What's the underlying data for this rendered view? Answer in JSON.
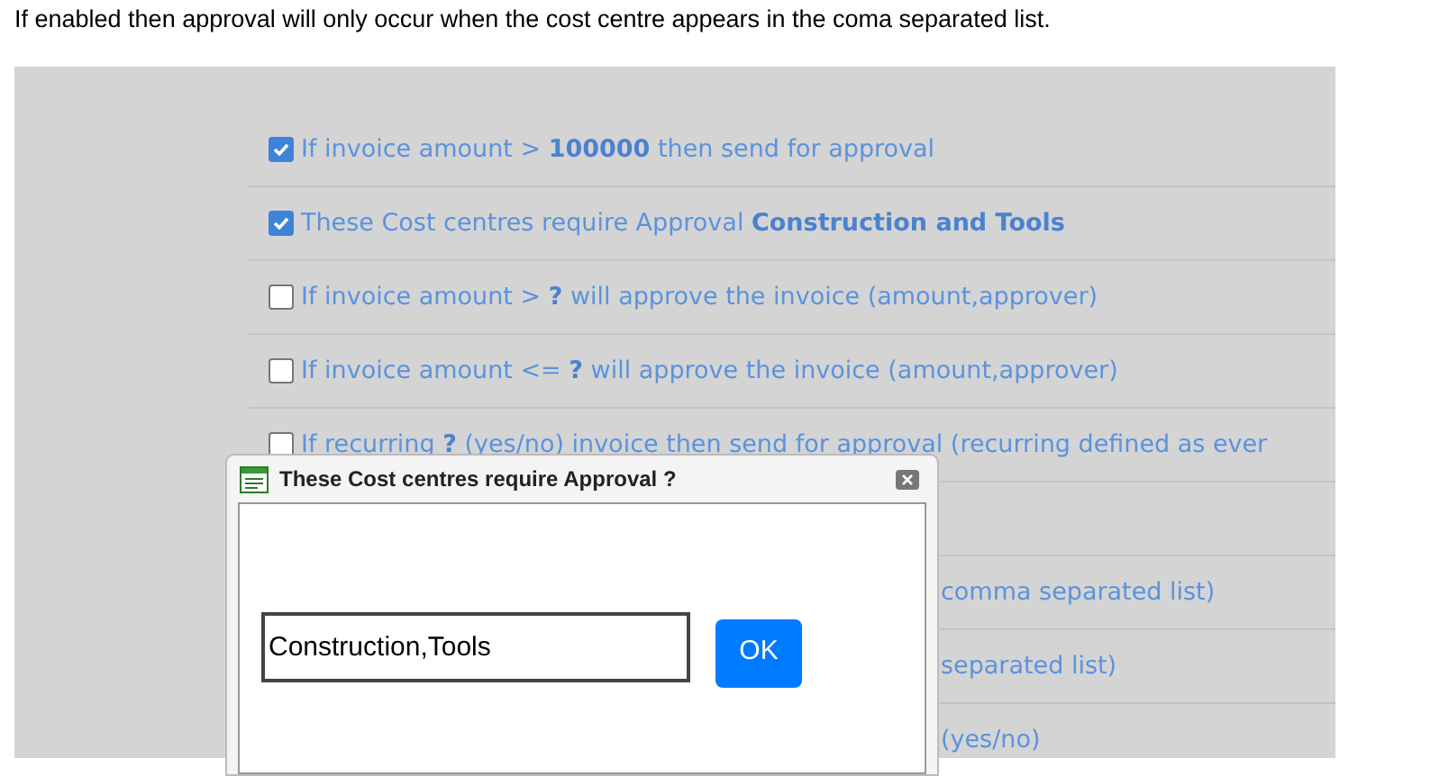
{
  "caption": "If enabled then approval will only occur when the cost centre appears in the coma separated list.",
  "rules": [
    {
      "kind": "checkbox",
      "checked": true,
      "text": "If invoice amount > **100000** then send for approval"
    },
    {
      "kind": "checkbox",
      "checked": true,
      "text": "These Cost centres require Approval **Construction and Tools**"
    },
    {
      "kind": "checkbox",
      "checked": false,
      "text": "If invoice amount > **?** will approve the invoice (amount,approver)"
    },
    {
      "kind": "checkbox",
      "checked": false,
      "text": "If invoice amount <= **?** will approve the invoice (amount,approver)"
    },
    {
      "kind": "checkbox",
      "checked": false,
      "text": "If recurring **?** (yes/no) invoice then send for approval (recurring defined as ever"
    },
    {
      "kind": "hidden"
    },
    {
      "kind": "covered",
      "text": "comma separated list)"
    },
    {
      "kind": "covered",
      "text": "separated list)"
    },
    {
      "kind": "covered",
      "text": "(yes/no)"
    }
  ],
  "dialog": {
    "title": "These Cost centres require Approval ?",
    "value": "Construction,Tools",
    "button": "OK"
  }
}
